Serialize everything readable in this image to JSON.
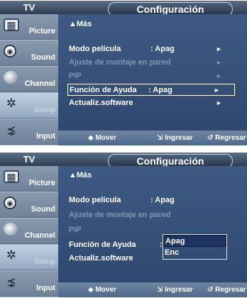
{
  "menus": [
    {
      "tv_label": "TV",
      "title": "Configuración",
      "sidebar": [
        {
          "label": "Picture",
          "icon": "picture-icon"
        },
        {
          "label": "Sound",
          "icon": "sound-icon"
        },
        {
          "label": "Channel",
          "icon": "channel-icon"
        },
        {
          "label": "Setup",
          "icon": "setup-icon",
          "active": true
        },
        {
          "label": "Input",
          "icon": "input-icon"
        }
      ],
      "mas_label": "▲Más",
      "rows": [
        {
          "label": "Modo película",
          "value": ": Apag",
          "arrow": "►",
          "disabled": false
        },
        {
          "label": "Ajuste de montaje en pared",
          "value": "",
          "arrow": "►",
          "disabled": true
        },
        {
          "label": "PIP",
          "value": "",
          "arrow": "►",
          "disabled": true
        },
        {
          "label": "Función de Ayuda",
          "value": ": Apag",
          "arrow": "►",
          "highlighted": true
        },
        {
          "label": "Actualiz.software",
          "value": "",
          "arrow": "►",
          "disabled": false
        }
      ],
      "hints": {
        "mover": "◆ Mover",
        "ingresar": "⇲ Ingresar",
        "regresar": "↺ Regresar"
      }
    },
    {
      "tv_label": "TV",
      "title": "Configuración",
      "sidebar": [
        {
          "label": "Picture",
          "icon": "picture-icon"
        },
        {
          "label": "Sound",
          "icon": "sound-icon"
        },
        {
          "label": "Channel",
          "icon": "channel-icon"
        },
        {
          "label": "Setup",
          "icon": "setup-icon",
          "active": true
        },
        {
          "label": "Input",
          "icon": "input-icon"
        }
      ],
      "mas_label": "▲Más",
      "rows": [
        {
          "label": "Modo película",
          "value": ": Apag",
          "disabled": false
        },
        {
          "label": "Ajuste de montaje en pared",
          "value": "",
          "disabled": true
        },
        {
          "label": "PIP",
          "value": "",
          "disabled": true
        },
        {
          "label": "Función de Ayuda",
          "value": ":",
          "disabled": false
        },
        {
          "label": "Actualiz.software",
          "value": "",
          "disabled": false
        }
      ],
      "dropdown": {
        "options": [
          "Apag",
          "Enc"
        ],
        "selected": "Apag"
      },
      "hints": {
        "mover": "◆ Mover",
        "ingresar": "⇲ Ingresar",
        "regresar": "↺ Regresar"
      }
    }
  ]
}
